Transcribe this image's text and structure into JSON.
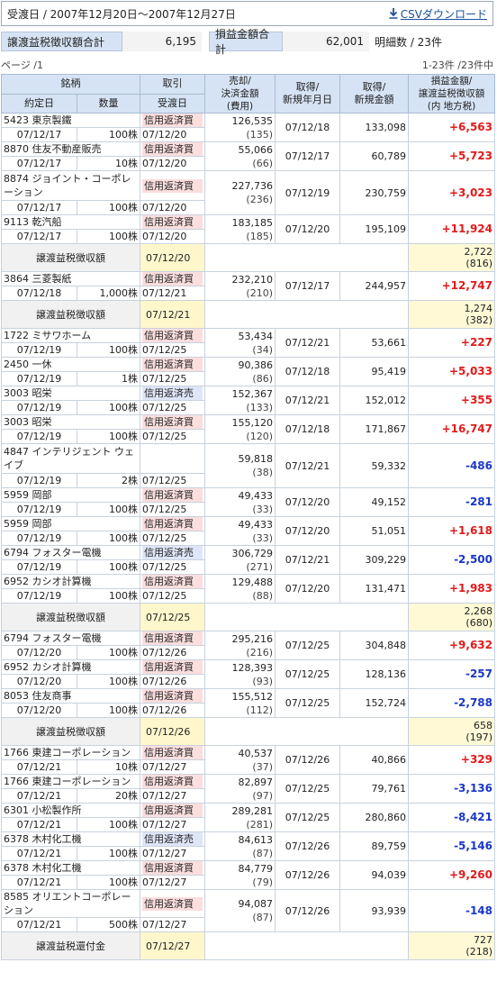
{
  "header": {
    "period_label": "受渡日 / 2007年12月20日～2007年12月27日",
    "csv_label": "CSVダウンロード",
    "csv_icon": "download-icon"
  },
  "summary": {
    "tax_withheld_label": "譲渡益税徴収額合計",
    "tax_withheld_value": "6,195",
    "pl_total_label": "損益金額合計",
    "pl_total_value": "62,001",
    "detail_count": "明細数 / 23件"
  },
  "pager": {
    "page": "ページ /1",
    "range": "1-23件 /23件中"
  },
  "columns": {
    "stock": "銘柄",
    "trade": "取引",
    "sell_amount": "売却/\n決済金額\n(費用)",
    "acq_date": "取得/\n新規年月日",
    "acq_amount": "取得/\n新規金額",
    "pl": "損益金額/\n譲渡益税徴収額\n(内 地方税)",
    "contract_date": "約定日",
    "quantity": "数量",
    "settle_date": "受渡日"
  },
  "rows": [
    {
      "type": "trade",
      "code_name": "5423 東京製鐵",
      "contract": "07/12/17",
      "qty": "100株",
      "kind": "信用返済買",
      "kind_color": "red",
      "settle": "07/12/20",
      "amount": "126,535",
      "fee": "(135)",
      "acq_date": "07/12/18",
      "acq_amount": "133,098",
      "pl": "+6,563",
      "pl_sign": "pos"
    },
    {
      "type": "trade",
      "code_name": "8870 住友不動産販売",
      "contract": "07/12/17",
      "qty": "10株",
      "kind": "信用返済買",
      "kind_color": "red",
      "settle": "07/12/20",
      "amount": "55,066",
      "fee": "(66)",
      "acq_date": "07/12/17",
      "acq_amount": "60,789",
      "pl": "+5,723",
      "pl_sign": "pos"
    },
    {
      "type": "trade",
      "code_name": "8874 ジョイント・コーポレーション",
      "contract": "07/12/17",
      "qty": "100株",
      "kind": "信用返済買",
      "kind_color": "red",
      "settle": "07/12/20",
      "amount": "227,736",
      "fee": "(236)",
      "acq_date": "07/12/19",
      "acq_amount": "230,759",
      "pl": "+3,023",
      "pl_sign": "pos"
    },
    {
      "type": "trade",
      "code_name": "9113 乾汽船",
      "contract": "07/12/17",
      "qty": "100株",
      "kind": "信用返済買",
      "kind_color": "red",
      "settle": "07/12/20",
      "amount": "183,185",
      "fee": "(185)",
      "acq_date": "07/12/20",
      "acq_amount": "195,109",
      "pl": "+11,924",
      "pl_sign": "pos"
    },
    {
      "type": "subtotal",
      "label": "譲渡益税徴収額",
      "date": "07/12/20",
      "tax": "2,722",
      "local": "(816)"
    },
    {
      "type": "trade",
      "code_name": "3864 三菱製紙",
      "contract": "07/12/18",
      "qty": "1,000株",
      "kind": "信用返済買",
      "kind_color": "red",
      "settle": "07/12/21",
      "amount": "232,210",
      "fee": "(210)",
      "acq_date": "07/12/17",
      "acq_amount": "244,957",
      "pl": "+12,747",
      "pl_sign": "pos"
    },
    {
      "type": "subtotal",
      "label": "譲渡益税徴収額",
      "date": "07/12/21",
      "tax": "1,274",
      "local": "(382)"
    },
    {
      "type": "trade",
      "code_name": "1722 ミサワホーム",
      "contract": "07/12/19",
      "qty": "100株",
      "kind": "信用返済買",
      "kind_color": "red",
      "settle": "07/12/25",
      "amount": "53,434",
      "fee": "(34)",
      "acq_date": "07/12/21",
      "acq_amount": "53,661",
      "pl": "+227",
      "pl_sign": "pos"
    },
    {
      "type": "trade",
      "code_name": "2450 一休",
      "contract": "07/12/19",
      "qty": "1株",
      "kind": "信用返済買",
      "kind_color": "red",
      "settle": "07/12/25",
      "amount": "90,386",
      "fee": "(86)",
      "acq_date": "07/12/18",
      "acq_amount": "95,419",
      "pl": "+5,033",
      "pl_sign": "pos"
    },
    {
      "type": "trade",
      "code_name": "3003 昭栄",
      "contract": "07/12/19",
      "qty": "100株",
      "kind": "信用返済売",
      "kind_color": "blue",
      "settle": "07/12/25",
      "amount": "152,367",
      "fee": "(133)",
      "acq_date": "07/12/21",
      "acq_amount": "152,012",
      "pl": "+355",
      "pl_sign": "pos"
    },
    {
      "type": "trade",
      "code_name": "3003 昭栄",
      "contract": "07/12/19",
      "qty": "100株",
      "kind": "信用返済買",
      "kind_color": "red",
      "settle": "07/12/25",
      "amount": "155,120",
      "fee": "(120)",
      "acq_date": "07/12/18",
      "acq_amount": "171,867",
      "pl": "+16,747",
      "pl_sign": "pos"
    },
    {
      "type": "trade",
      "code_name": "4847 インテリジェント ウェイブ",
      "contract": "07/12/19",
      "qty": "2株",
      "kind": "",
      "kind_color": "none",
      "settle": "07/12/25",
      "amount": "59,818",
      "fee": "(38)",
      "acq_date": "07/12/21",
      "acq_amount": "59,332",
      "pl": "-486",
      "pl_sign": "neg"
    },
    {
      "type": "trade",
      "code_name": "5959 岡部",
      "contract": "07/12/19",
      "qty": "100株",
      "kind": "信用返済買",
      "kind_color": "red",
      "settle": "07/12/25",
      "amount": "49,433",
      "fee": "(33)",
      "acq_date": "07/12/20",
      "acq_amount": "49,152",
      "pl": "-281",
      "pl_sign": "neg"
    },
    {
      "type": "trade",
      "code_name": "5959 岡部",
      "contract": "07/12/19",
      "qty": "100株",
      "kind": "信用返済買",
      "kind_color": "red",
      "settle": "07/12/25",
      "amount": "49,433",
      "fee": "(33)",
      "acq_date": "07/12/20",
      "acq_amount": "51,051",
      "pl": "+1,618",
      "pl_sign": "pos"
    },
    {
      "type": "trade",
      "code_name": "6794 フォスター電機",
      "contract": "07/12/19",
      "qty": "100株",
      "kind": "信用返済売",
      "kind_color": "blue",
      "settle": "07/12/25",
      "amount": "306,729",
      "fee": "(271)",
      "acq_date": "07/12/21",
      "acq_amount": "309,229",
      "pl": "-2,500",
      "pl_sign": "neg"
    },
    {
      "type": "trade",
      "code_name": "6952 カシオ計算機",
      "contract": "07/12/19",
      "qty": "100株",
      "kind": "信用返済買",
      "kind_color": "red",
      "settle": "07/12/25",
      "amount": "129,488",
      "fee": "(88)",
      "acq_date": "07/12/20",
      "acq_amount": "131,471",
      "pl": "+1,983",
      "pl_sign": "pos"
    },
    {
      "type": "subtotal",
      "label": "譲渡益税徴収額",
      "date": "07/12/25",
      "tax": "2,268",
      "local": "(680)"
    },
    {
      "type": "trade",
      "code_name": "6794 フォスター電機",
      "contract": "07/12/20",
      "qty": "100株",
      "kind": "信用返済買",
      "kind_color": "red",
      "settle": "07/12/26",
      "amount": "295,216",
      "fee": "(216)",
      "acq_date": "07/12/25",
      "acq_amount": "304,848",
      "pl": "+9,632",
      "pl_sign": "pos"
    },
    {
      "type": "trade",
      "code_name": "6952 カシオ計算機",
      "contract": "07/12/20",
      "qty": "100株",
      "kind": "信用返済買",
      "kind_color": "red",
      "settle": "07/12/26",
      "amount": "128,393",
      "fee": "(93)",
      "acq_date": "07/12/25",
      "acq_amount": "128,136",
      "pl": "-257",
      "pl_sign": "neg"
    },
    {
      "type": "trade",
      "code_name": "8053 住友商事",
      "contract": "07/12/20",
      "qty": "100株",
      "kind": "信用返済買",
      "kind_color": "red",
      "settle": "07/12/26",
      "amount": "155,512",
      "fee": "(112)",
      "acq_date": "07/12/25",
      "acq_amount": "152,724",
      "pl": "-2,788",
      "pl_sign": "neg"
    },
    {
      "type": "subtotal",
      "label": "譲渡益税徴収額",
      "date": "07/12/26",
      "tax": "658",
      "local": "(197)"
    },
    {
      "type": "trade",
      "code_name": "1766 東建コーポレーション",
      "contract": "07/12/21",
      "qty": "10株",
      "kind": "信用返済買",
      "kind_color": "red",
      "settle": "07/12/27",
      "amount": "40,537",
      "fee": "(37)",
      "acq_date": "07/12/26",
      "acq_amount": "40,866",
      "pl": "+329",
      "pl_sign": "pos"
    },
    {
      "type": "trade",
      "code_name": "1766 東建コーポレーション",
      "contract": "07/12/21",
      "qty": "20株",
      "kind": "信用返済買",
      "kind_color": "red",
      "settle": "07/12/27",
      "amount": "82,897",
      "fee": "(97)",
      "acq_date": "07/12/25",
      "acq_amount": "79,761",
      "pl": "-3,136",
      "pl_sign": "neg"
    },
    {
      "type": "trade",
      "code_name": "6301 小松製作所",
      "contract": "07/12/21",
      "qty": "100株",
      "kind": "信用返済買",
      "kind_color": "red",
      "settle": "07/12/27",
      "amount": "289,281",
      "fee": "(281)",
      "acq_date": "07/12/25",
      "acq_amount": "280,860",
      "pl": "-8,421",
      "pl_sign": "neg"
    },
    {
      "type": "trade",
      "code_name": "6378 木村化工機",
      "contract": "07/12/21",
      "qty": "100株",
      "kind": "信用返済売",
      "kind_color": "blue",
      "settle": "07/12/27",
      "amount": "84,613",
      "fee": "(87)",
      "acq_date": "07/12/26",
      "acq_amount": "89,759",
      "pl": "-5,146",
      "pl_sign": "neg"
    },
    {
      "type": "trade",
      "code_name": "6378 木村化工機",
      "contract": "07/12/21",
      "qty": "100株",
      "kind": "信用返済買",
      "kind_color": "red",
      "settle": "07/12/27",
      "amount": "84,779",
      "fee": "(79)",
      "acq_date": "07/12/26",
      "acq_amount": "94,039",
      "pl": "+9,260",
      "pl_sign": "pos"
    },
    {
      "type": "trade",
      "code_name": "8585 オリエントコーポレーション",
      "contract": "07/12/21",
      "qty": "500株",
      "kind": "信用返済買",
      "kind_color": "red",
      "settle": "07/12/27",
      "amount": "94,087",
      "fee": "(87)",
      "acq_date": "07/12/26",
      "acq_amount": "93,939",
      "pl": "-148",
      "pl_sign": "neg"
    },
    {
      "type": "subtotal",
      "label": "譲渡益税還付金",
      "date": "07/12/27",
      "tax": "727",
      "local": "(218)"
    }
  ],
  "colors": {
    "positive": "#e21a1a",
    "negative": "#1a37c8",
    "header_bg": "#d5e3f4",
    "subtotal_bg": "#fff9d6"
  }
}
